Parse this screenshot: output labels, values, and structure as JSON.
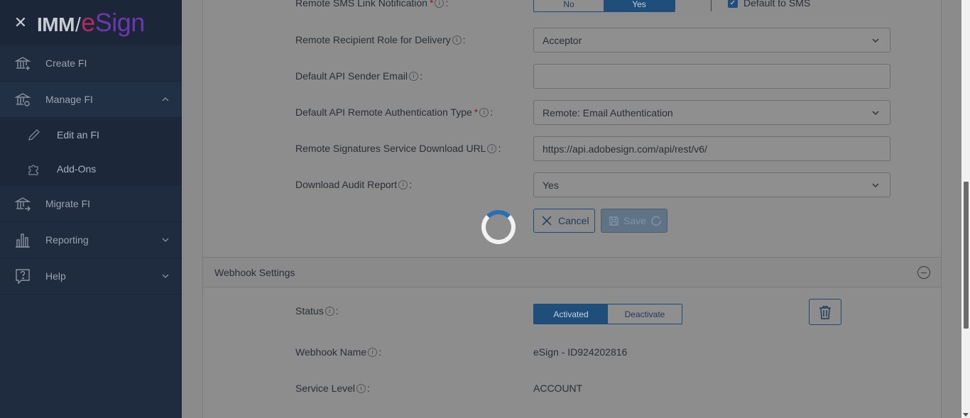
{
  "sidebar": {
    "close_icon": "close-icon",
    "logo_imm": "IMM",
    "logo_esign_e": "e",
    "logo_esign_rest": "Sign",
    "items": [
      {
        "label": "Create FI",
        "icon": "bank-plus-icon"
      },
      {
        "label": "Manage FI",
        "icon": "bank-gear-icon",
        "expanded": true
      },
      {
        "label": "Edit an FI",
        "icon": "pencil-icon"
      },
      {
        "label": "Add-Ons",
        "icon": "puzzle-icon"
      },
      {
        "label": "Migrate FI",
        "icon": "bank-arrow-icon"
      },
      {
        "label": "Reporting",
        "icon": "bar-chart-icon"
      },
      {
        "label": "Help",
        "icon": "help-bubble-icon"
      }
    ]
  },
  "form": {
    "sms_label": "Remote SMS Link Notification",
    "sms_no": "No",
    "sms_yes": "Yes",
    "sms_default_label": "Default to SMS",
    "role_label": "Remote Recipient Role for Delivery",
    "role_value": "Acceptor",
    "sender_email_label": "Default API Sender Email",
    "sender_email_value": "",
    "auth_type_label": "Default API Remote Authentication Type",
    "auth_type_value": "Remote: Email Authentication",
    "download_url_label": "Remote Signatures Service Download URL",
    "download_url_value": "https://api.adobesign.com/api/rest/v6/",
    "audit_label": "Download Audit Report",
    "audit_value": "Yes",
    "required_mark": "*",
    "info_mark": "i",
    "colon": ":",
    "cancel_label": "Cancel",
    "save_label": "Save"
  },
  "webhook": {
    "section_title": "Webhook Settings",
    "status_label": "Status",
    "status_activated": "Activated",
    "status_deactivate": "Deactivate",
    "name_label": "Webhook Name",
    "name_value": "eSign - ID924202816",
    "service_level_label": "Service Level",
    "service_level_value": "ACCOUNT"
  },
  "colors": {
    "sidebar_bg": "#1f2c3f",
    "accent": "#1f4e7a",
    "spinner": "#2a6fb0"
  }
}
